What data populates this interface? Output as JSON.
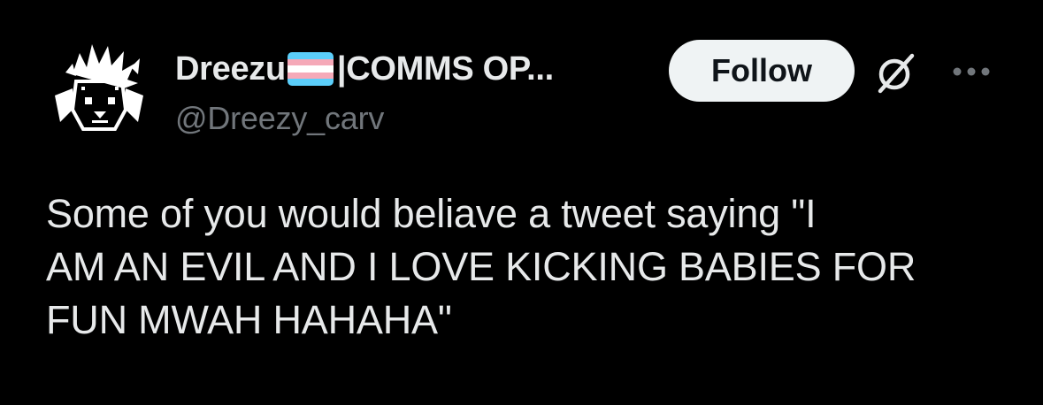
{
  "author": {
    "display_name": "Dreezu",
    "display_name_suffix": "|COMMS OP...",
    "handle": "@Dreezy_carv",
    "flag_colors": [
      "#5bcefa",
      "#f5a9b8",
      "#ffffff",
      "#f5a9b8",
      "#5bcefa"
    ]
  },
  "actions": {
    "follow_label": "Follow",
    "grok_icon": "grok-icon",
    "more_icon": "more-icon"
  },
  "tweet": {
    "lines": [
      "Some of you would beliave a tweet saying \"I",
      "AM AN EVIL AND I LOVE KICKING BABIES FOR",
      "FUN MWAH HAHAHA\""
    ]
  },
  "colors": {
    "background": "#000000",
    "text_primary": "#e7e9ea",
    "text_secondary": "#71767b",
    "button_bg": "#eff3f4",
    "button_text": "#0f1419"
  }
}
